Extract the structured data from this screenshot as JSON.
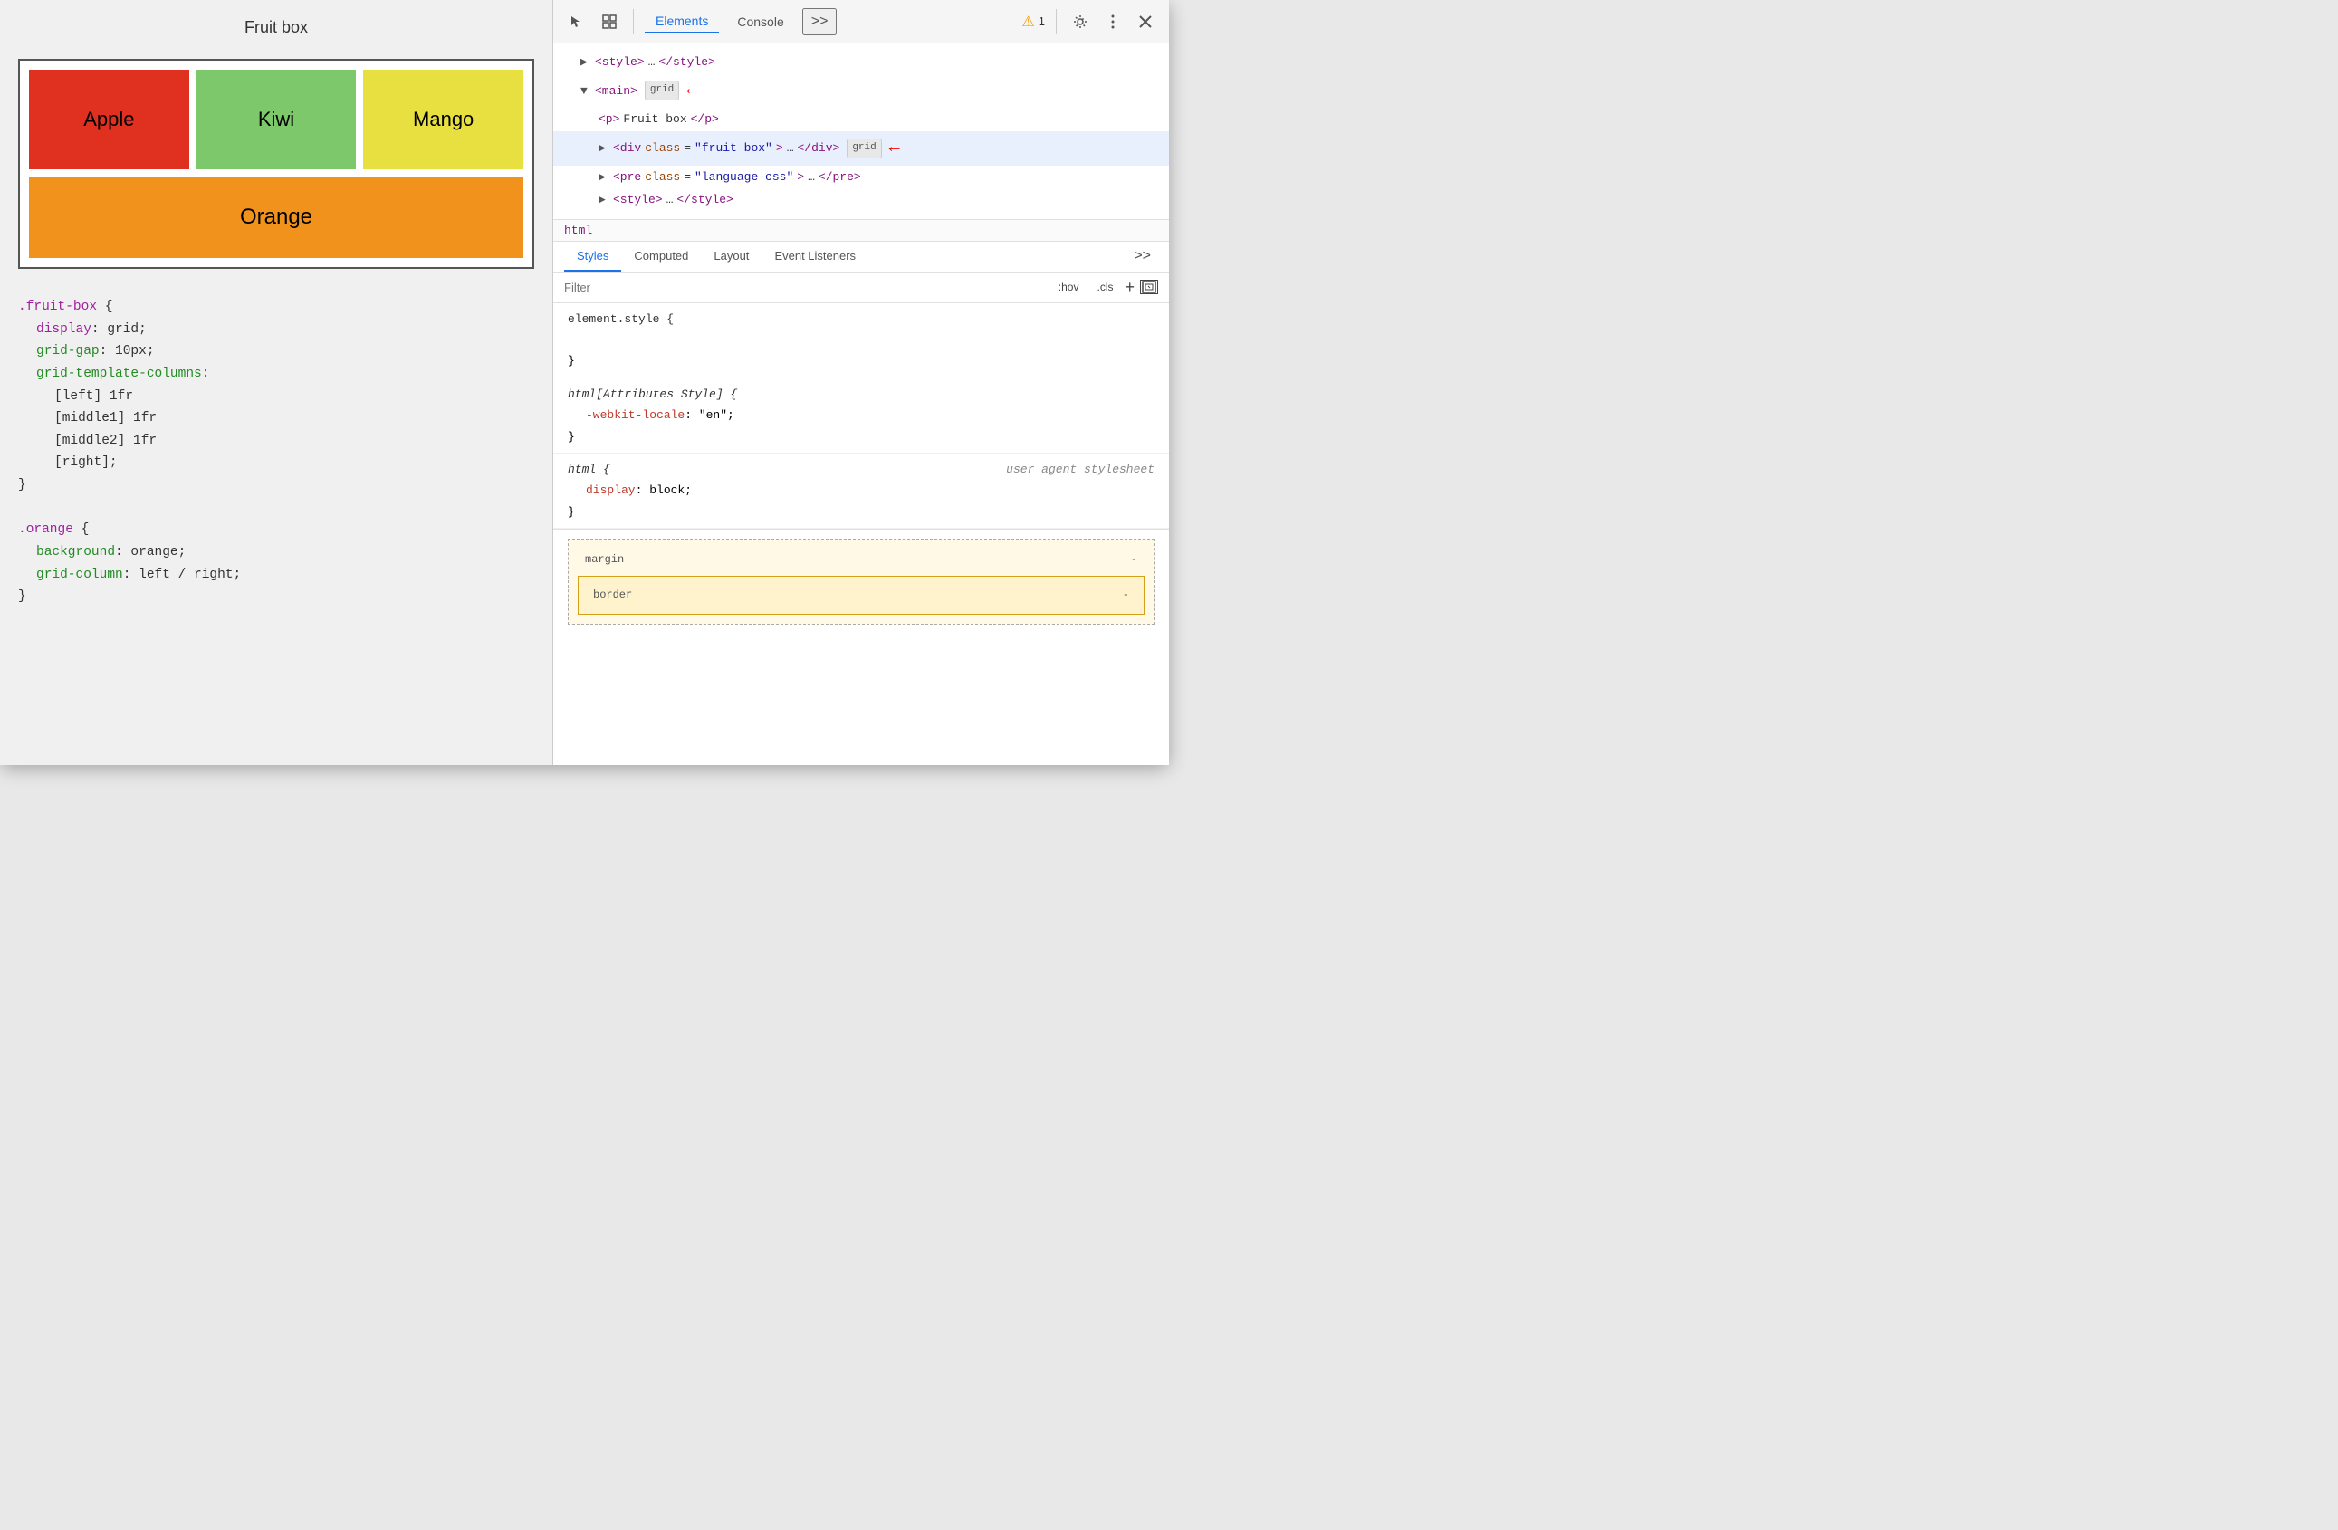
{
  "left": {
    "title": "Fruit box",
    "fruits": [
      {
        "name": "Apple",
        "class": "fruit-apple"
      },
      {
        "name": "Kiwi",
        "class": "fruit-kiwi"
      },
      {
        "name": "Mango",
        "class": "fruit-mango"
      },
      {
        "name": "Orange",
        "class": "fruit-orange"
      }
    ],
    "code": {
      "block1": {
        "selector": ".fruit-box {",
        "lines": [
          "display: grid;",
          "grid-gap: 10px;",
          "grid-template-columns:",
          "[left] 1fr",
          "[middle1] 1fr",
          "[middle2] 1fr",
          "[right];"
        ],
        "close": "}"
      },
      "block2": {
        "selector": ".orange {",
        "lines": [
          "background: orange;",
          "grid-column: left / right;"
        ],
        "close": "}"
      }
    }
  },
  "devtools": {
    "tabs": [
      "Elements",
      "Console",
      ">>"
    ],
    "active_tab": "Elements",
    "warning_count": "1",
    "dom_tree": [
      {
        "indent": 1,
        "content": "▶ <style>…</style>",
        "selected": false
      },
      {
        "indent": 1,
        "content": "▼ <main>",
        "badge": "grid",
        "has_arrow": true,
        "selected": false
      },
      {
        "indent": 2,
        "content": "<p>Fruit box</p>",
        "selected": false
      },
      {
        "indent": 2,
        "content": "▶ <div class=\"fruit-box\">…</div>",
        "badge": "grid",
        "has_arrow": true,
        "selected": true
      },
      {
        "indent": 2,
        "content": "▶ <pre class=\"language-css\">…</pre>",
        "selected": false
      },
      {
        "indent": 2,
        "content": "▶ <style>…</style>",
        "selected": false
      }
    ],
    "breadcrumb": "html",
    "styles_tabs": [
      "Styles",
      "Computed",
      "Layout",
      "Event Listeners",
      ">>"
    ],
    "active_styles_tab": "Styles",
    "filter_placeholder": "Filter",
    "filter_buttons": [
      ":hov",
      ".cls",
      "+"
    ],
    "style_rules": [
      {
        "selector": "element.style {",
        "properties": [],
        "close": "}"
      },
      {
        "selector": "html[Attributes Style] {",
        "properties": [
          {
            "name": "-webkit-locale",
            "value": "\"en\";"
          }
        ],
        "close": "}"
      },
      {
        "selector": "html {",
        "comment": "user agent stylesheet",
        "properties": [
          {
            "name": "display",
            "value": "block;"
          }
        ],
        "close": "}"
      }
    ],
    "box_model": {
      "margin_label": "margin",
      "margin_value": "-",
      "border_label": "border",
      "border_value": "-"
    }
  }
}
